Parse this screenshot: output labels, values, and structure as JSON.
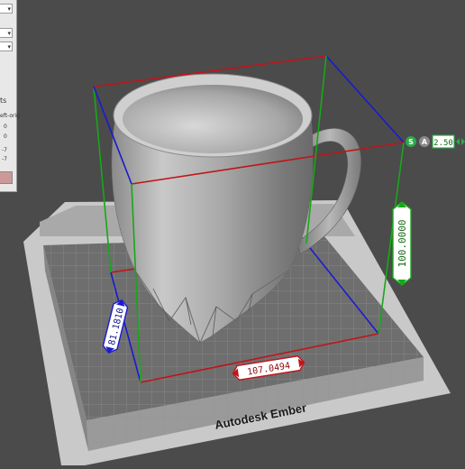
{
  "printer": {
    "brand_label": "Autodesk Ember"
  },
  "panel": {
    "row_labels": [
      "",
      "",
      ""
    ],
    "section_label": "ts",
    "sub_label": "eft-orig",
    "values": [
      "0",
      "0",
      "-7",
      "-7"
    ]
  },
  "dimensions": {
    "height": "100.0000",
    "width": "107.0494",
    "depth": "81.1810"
  },
  "scale_control": {
    "value": "2.50",
    "s_label": "S",
    "a_label": "A"
  },
  "colors": {
    "background": "#4a4a4a",
    "bbox_red": "#c0141b",
    "bbox_blue": "#1a1ad0",
    "bbox_green": "#17a817"
  }
}
